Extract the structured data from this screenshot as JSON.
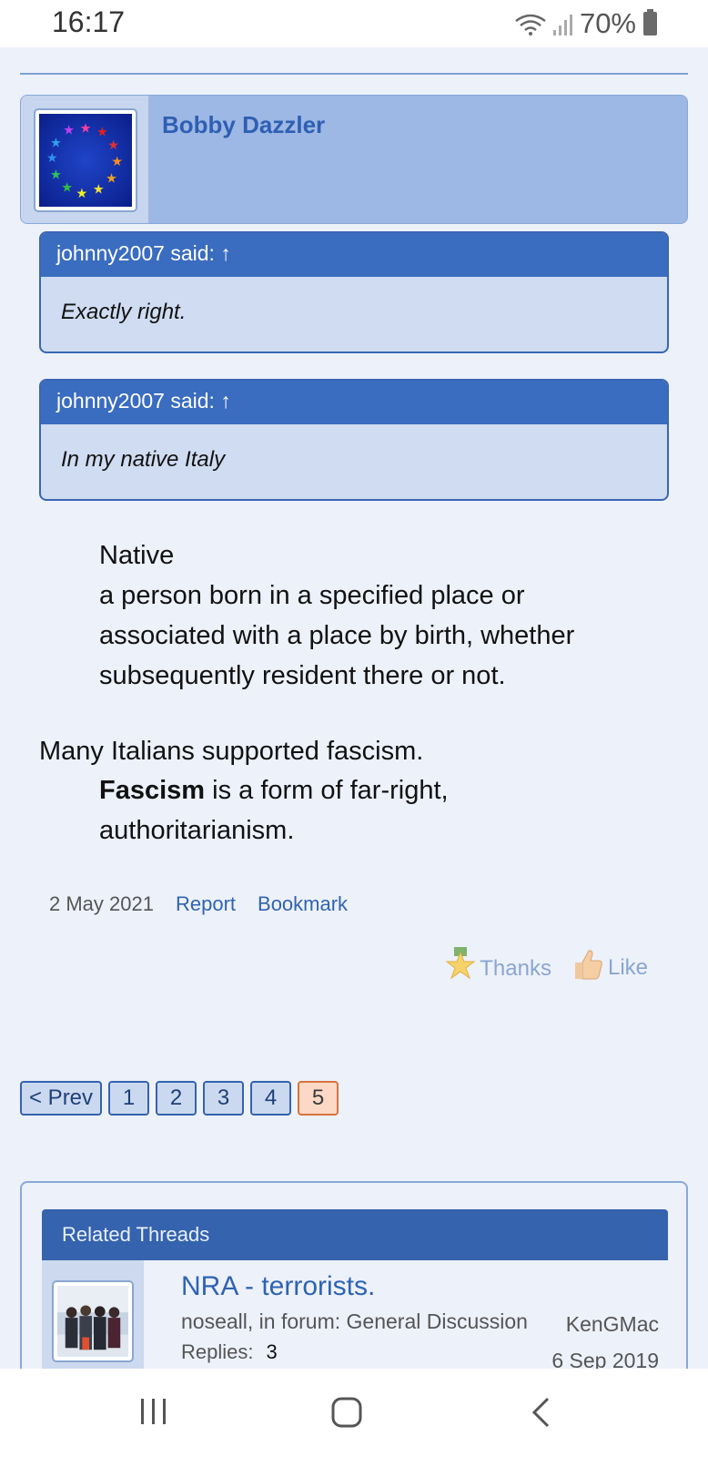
{
  "status_bar": {
    "time": "16:17",
    "battery": "70%"
  },
  "post": {
    "author": "Bobby Dazzler",
    "quotes": [
      {
        "header": "johnny2007 said: ↑",
        "text": "Exactly right."
      },
      {
        "header": "johnny2007 said: ↑",
        "text": "In my native Italy"
      }
    ],
    "definition": {
      "term": "Native",
      "lines": [
        "a person born in a specified place or",
        "associated with a place by birth, whether",
        "subsequently resident there or not."
      ]
    },
    "statement": "Many Italians supported fascism.",
    "fascism": {
      "bold": "Fascism",
      "rest": " is a form of far-right,",
      "line2": "authoritarianism."
    },
    "date": "2 May 2021",
    "report_label": "Report",
    "bookmark_label": "Bookmark",
    "thanks_label": "Thanks",
    "like_label": "Like"
  },
  "pagination": {
    "prev_label": "< Prev",
    "pages": [
      "1",
      "2",
      "3",
      "4",
      "5"
    ],
    "current": "5"
  },
  "related": {
    "heading": "Related Threads",
    "threads": [
      {
        "title": "NRA - terrorists.",
        "meta": "noseall, in forum: General Discussion",
        "replies_label": "Replies:",
        "replies": "3",
        "last_poster": "KenGMac",
        "last_date": "6 Sep 2019"
      }
    ]
  },
  "colors": {
    "accent": "#3563ad",
    "current_page": "#fbd9c6",
    "background": "#edf1fa"
  }
}
